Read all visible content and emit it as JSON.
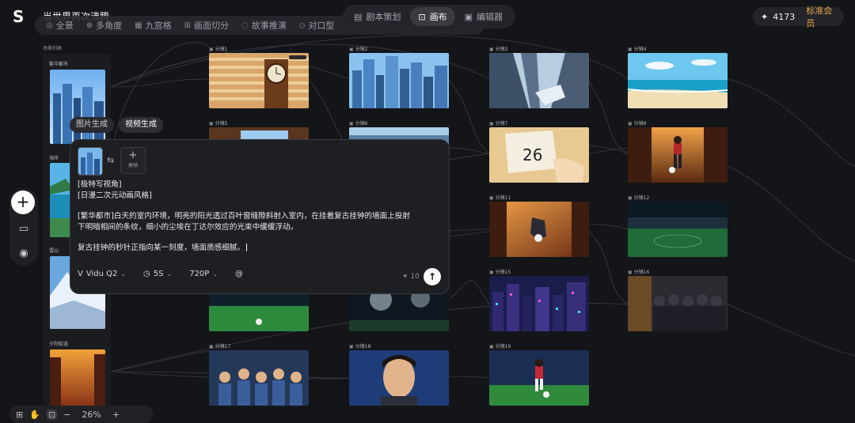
{
  "app": {
    "logo": "S",
    "project_title": "当世界再次沸腾"
  },
  "view_toolbar": {
    "items": [
      {
        "icon": "panorama-icon",
        "label": "全景"
      },
      {
        "icon": "multi-angle-icon",
        "label": "多角度"
      },
      {
        "icon": "grid-icon",
        "label": "九宫格"
      },
      {
        "icon": "cut-icon",
        "label": "画面切分"
      },
      {
        "icon": "story-icon",
        "label": "故事推演"
      },
      {
        "icon": "lipsync-icon",
        "label": "对口型"
      },
      {
        "icon": "link-icon",
        "label": "..."
      }
    ]
  },
  "main_tabs": [
    {
      "icon": "script-icon",
      "label": "剧本策划",
      "active": false
    },
    {
      "icon": "canvas-icon",
      "label": "画布",
      "active": true
    },
    {
      "icon": "editor-icon",
      "label": "编辑器",
      "active": false
    }
  ],
  "account": {
    "credits": "4173",
    "membership": "标准会员"
  },
  "scene_list": {
    "title": "场景列表",
    "items": [
      {
        "label": "繁华都市"
      },
      {
        "label": "海岸"
      },
      {
        "label": "雪山"
      },
      {
        "label": "夕阳街道"
      }
    ]
  },
  "shots": [
    {
      "label": "分镜1"
    },
    {
      "label": "分镜2"
    },
    {
      "label": "分镜3"
    },
    {
      "label": "分镜4"
    },
    {
      "label": "分镜5"
    },
    {
      "label": "分镜6"
    },
    {
      "label": "分镜7"
    },
    {
      "label": "分镜8"
    },
    {
      "label": "分镜11"
    },
    {
      "label": "分镜12"
    },
    {
      "label": "分镜15"
    },
    {
      "label": "分镜16"
    },
    {
      "label": "分镜17"
    },
    {
      "label": "分镜18"
    },
    {
      "label": "分镜19"
    }
  ],
  "generator": {
    "tabs": [
      {
        "label": "图片生成",
        "active": false
      },
      {
        "label": "视频生成",
        "active": true
      }
    ],
    "tail_frame_label": "尾帧",
    "prompt_lines": [
      "[极特写视角]",
      "[日漫二次元动画风格]",
      "",
      "[繁华都市]白天的室内环境，明亮的阳光透过百叶窗缝隙斜射入室内，在挂着复古挂钟的墙面上投射",
      "下明暗相间的条纹，细小的尘埃在丁达尔效应的光束中缓缓浮动。",
      "",
      "复古挂钟的秒针正指向某一刻度，墙面质感细腻。"
    ],
    "model": "Vidu Q2",
    "duration": "5S",
    "resolution": "720P",
    "mention": "@",
    "cost": "10"
  },
  "bottom_toolbar": {
    "zoom": "26%",
    "minus": "−",
    "plus": "+"
  }
}
